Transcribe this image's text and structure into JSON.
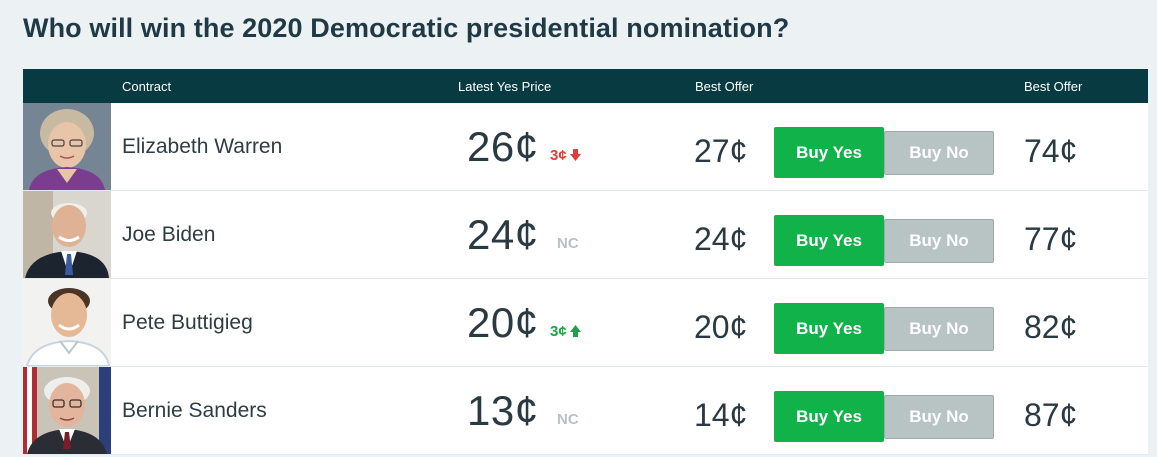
{
  "title": "Who will win the 2020 Democratic presidential nomination?",
  "header": {
    "contract": "Contract",
    "latest_yes_price": "Latest Yes Price",
    "best_offer_yes": "Best Offer",
    "best_offer_no": "Best Offer"
  },
  "colors": {
    "header_bg": "#073b41",
    "buy_yes": "#12b24a",
    "buy_no": "#b8c3c4",
    "down": "#e23b3b",
    "up": "#1ba345"
  },
  "rows": [
    {
      "name": "Elizabeth Warren",
      "price": "26¢",
      "change": "3¢",
      "direction": "down",
      "best_offer_yes": "27¢",
      "buy_yes": "Buy Yes",
      "buy_no": "Buy No",
      "best_offer_no": "74¢"
    },
    {
      "name": "Joe Biden",
      "price": "24¢",
      "change": "NC",
      "direction": "none",
      "best_offer_yes": "24¢",
      "buy_yes": "Buy Yes",
      "buy_no": "Buy No",
      "best_offer_no": "77¢"
    },
    {
      "name": "Pete Buttigieg",
      "price": "20¢",
      "change": "3¢",
      "direction": "up",
      "best_offer_yes": "20¢",
      "buy_yes": "Buy Yes",
      "buy_no": "Buy No",
      "best_offer_no": "82¢"
    },
    {
      "name": "Bernie Sanders",
      "price": "13¢",
      "change": "NC",
      "direction": "none",
      "best_offer_yes": "14¢",
      "buy_yes": "Buy Yes",
      "buy_no": "Buy No",
      "best_offer_no": "87¢"
    }
  ]
}
